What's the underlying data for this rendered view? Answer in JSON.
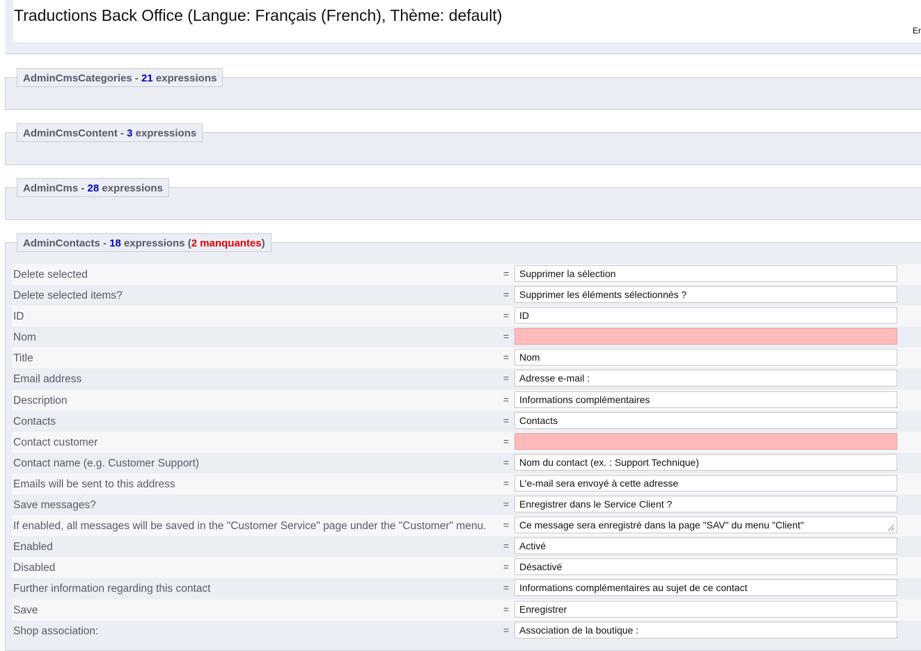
{
  "header": {
    "title": "Traductions Back Office (Langue: Français (French), Thème: default)",
    "lang_link": "Er"
  },
  "sections": [
    {
      "name": "AdminCmsCategories",
      "sep": " - ",
      "count": "21",
      "label": " expressions"
    },
    {
      "name": "AdminCmsContent",
      "sep": " - ",
      "count": "3",
      "label": " expressions"
    },
    {
      "name": "AdminCms",
      "sep": " - ",
      "count": "28",
      "label": " expressions"
    },
    {
      "name": "AdminContacts",
      "sep": " - ",
      "count": "18",
      "label": " expressions (",
      "missing": "2 manquantes",
      "close": ")"
    }
  ],
  "contacts_rows": [
    {
      "label": "Delete selected",
      "value": "Supprimer la sélection"
    },
    {
      "label": "Delete selected items?",
      "value": "Supprimer les éléments sélectionnés ?"
    },
    {
      "label": "ID",
      "value": "ID"
    },
    {
      "label": "Nom",
      "value": ""
    },
    {
      "label": "Title",
      "value": "Nom"
    },
    {
      "label": "Email address",
      "value": "Adresse e-mail :"
    },
    {
      "label": "Description",
      "value": "Informations complémentaires"
    },
    {
      "label": "Contacts",
      "value": "Contacts"
    },
    {
      "label": "Contact customer",
      "value": ""
    },
    {
      "label": "Contact name (e.g. Customer Support)",
      "value": "Nom du contact (ex. : Support Technique)"
    },
    {
      "label": "Emails will be sent to this address",
      "value": "L'e-mail sera envoyé à cette adresse"
    },
    {
      "label": "Save messages?",
      "value": "Enregistrer dans le Service Client ?"
    },
    {
      "label": "If enabled, all messages will be saved in the \"Customer Service\" page under the \"Customer\" menu.",
      "value": "Ce message sera enregistré dans la page \"SAV\" du menu \"Client\""
    },
    {
      "label": "Enabled",
      "value": "Activé"
    },
    {
      "label": "Disabled",
      "value": "Désactivé"
    },
    {
      "label": "Further information regarding this contact",
      "value": "Informations complémentaires au sujet de ce contact"
    },
    {
      "label": "Save",
      "value": "Enregistrer"
    },
    {
      "label": "Shop association:",
      "value": "Association de la boutique :"
    }
  ],
  "equals_sign": "=",
  "colors": {
    "count": "#0000cc",
    "missing": "#e60000",
    "missing_field_bg": "#ffbbbb",
    "section_bg": "#eceef5"
  }
}
